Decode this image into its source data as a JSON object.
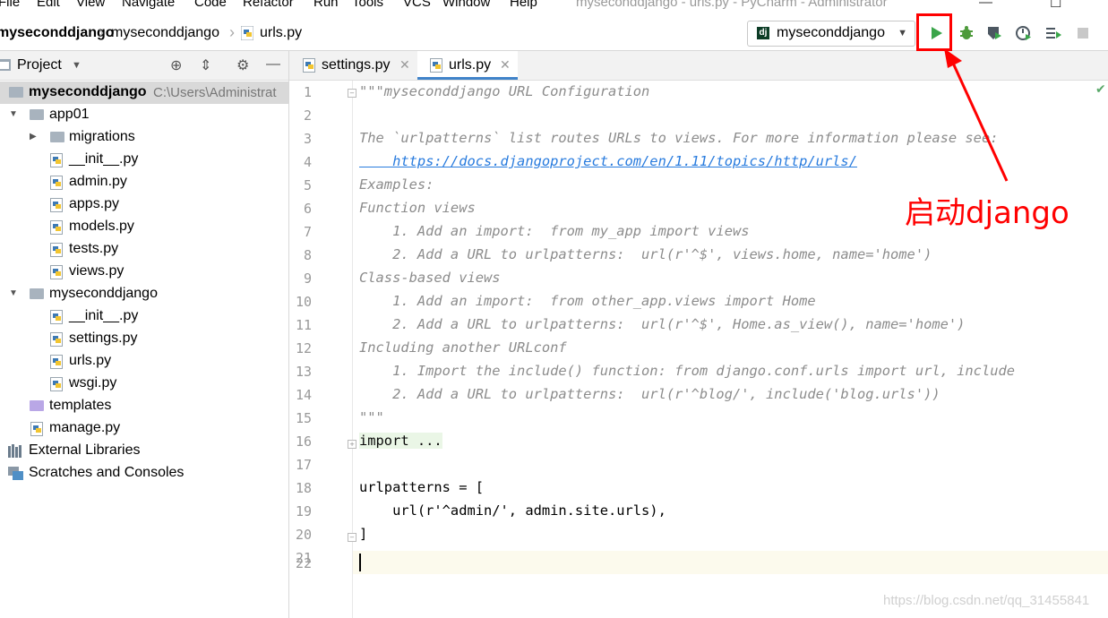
{
  "menu": [
    "File",
    "Edit",
    "View",
    "Navigate",
    "Code",
    "Refactor",
    "Run",
    "Tools",
    "VCS",
    "Window",
    "Help"
  ],
  "window_title": "myseconddjango - urls.py - PyCharm - Administrator",
  "breadcrumbs": [
    "myseconddjango",
    "myseconddjango",
    "urls.py"
  ],
  "run_config": {
    "label": "myseconddjango",
    "icon": "dj"
  },
  "toolbar_icons": [
    "run-icon",
    "debug-icon",
    "coverage-icon",
    "profile-icon",
    "run-list-icon",
    "stop-icon"
  ],
  "sidebar": {
    "title": "Project",
    "tree": [
      {
        "label": "myseconddjango",
        "path": "C:\\Users\\Administrat",
        "level": 0,
        "type": "root"
      },
      {
        "label": "app01",
        "level": 1,
        "type": "folder",
        "expanded": true
      },
      {
        "label": "migrations",
        "level": 2,
        "type": "folder",
        "expanded": false
      },
      {
        "label": "__init__.py",
        "level": 2,
        "type": "py"
      },
      {
        "label": "admin.py",
        "level": 2,
        "type": "py"
      },
      {
        "label": "apps.py",
        "level": 2,
        "type": "py"
      },
      {
        "label": "models.py",
        "level": 2,
        "type": "py"
      },
      {
        "label": "tests.py",
        "level": 2,
        "type": "py"
      },
      {
        "label": "views.py",
        "level": 2,
        "type": "py"
      },
      {
        "label": "myseconddjango",
        "level": 1,
        "type": "folder",
        "expanded": true
      },
      {
        "label": "__init__.py",
        "level": 2,
        "type": "py"
      },
      {
        "label": "settings.py",
        "level": 2,
        "type": "py"
      },
      {
        "label": "urls.py",
        "level": 2,
        "type": "py"
      },
      {
        "label": "wsgi.py",
        "level": 2,
        "type": "py"
      },
      {
        "label": "templates",
        "level": 1,
        "type": "template-folder"
      },
      {
        "label": "manage.py",
        "level": 1,
        "type": "py"
      },
      {
        "label": "External Libraries",
        "level": 0,
        "type": "libraries"
      },
      {
        "label": "Scratches and Consoles",
        "level": 0,
        "type": "scratches"
      }
    ]
  },
  "tabs": [
    {
      "label": "settings.py",
      "active": false
    },
    {
      "label": "urls.py",
      "active": true
    }
  ],
  "editor": {
    "line_numbers": [
      "1",
      "2",
      "3",
      "4",
      "5",
      "6",
      "7",
      "8",
      "9",
      "10",
      "11",
      "12",
      "13",
      "14",
      "15",
      "16",
      "17",
      "18",
      "19",
      "20",
      "21",
      "22"
    ],
    "lines": [
      "\"\"\"myseconddjango URL Configuration",
      "",
      "The `urlpatterns` list routes URLs to views. For more information please see:",
      "    https://docs.djangoproject.com/en/1.11/topics/http/urls/",
      "Examples:",
      "Function views",
      "    1. Add an import:  from my_app import views",
      "    2. Add a URL to urlpatterns:  url(r'^$', views.home, name='home')",
      "Class-based views",
      "    1. Add an import:  from other_app.views import Home",
      "    2. Add a URL to urlpatterns:  url(r'^$', Home.as_view(), name='home')",
      "Including another URLconf",
      "    1. Import the include() function: from django.conf.urls import url, include",
      "    2. Add a URL to urlpatterns:  url(r'^blog/', include('blog.urls'))",
      "\"\"\"",
      "import ...",
      "",
      "urlpatterns = [",
      "    url(r'^admin/', admin.site.urls),",
      "]",
      ""
    ]
  },
  "annotation": "启动django",
  "watermark": "https://blog.csdn.net/qq_31455841",
  "colors": {
    "highlight": "#ff0000",
    "run_green": "#3aa54a",
    "docstring": "#8c8c8c",
    "link": "#287bde"
  }
}
